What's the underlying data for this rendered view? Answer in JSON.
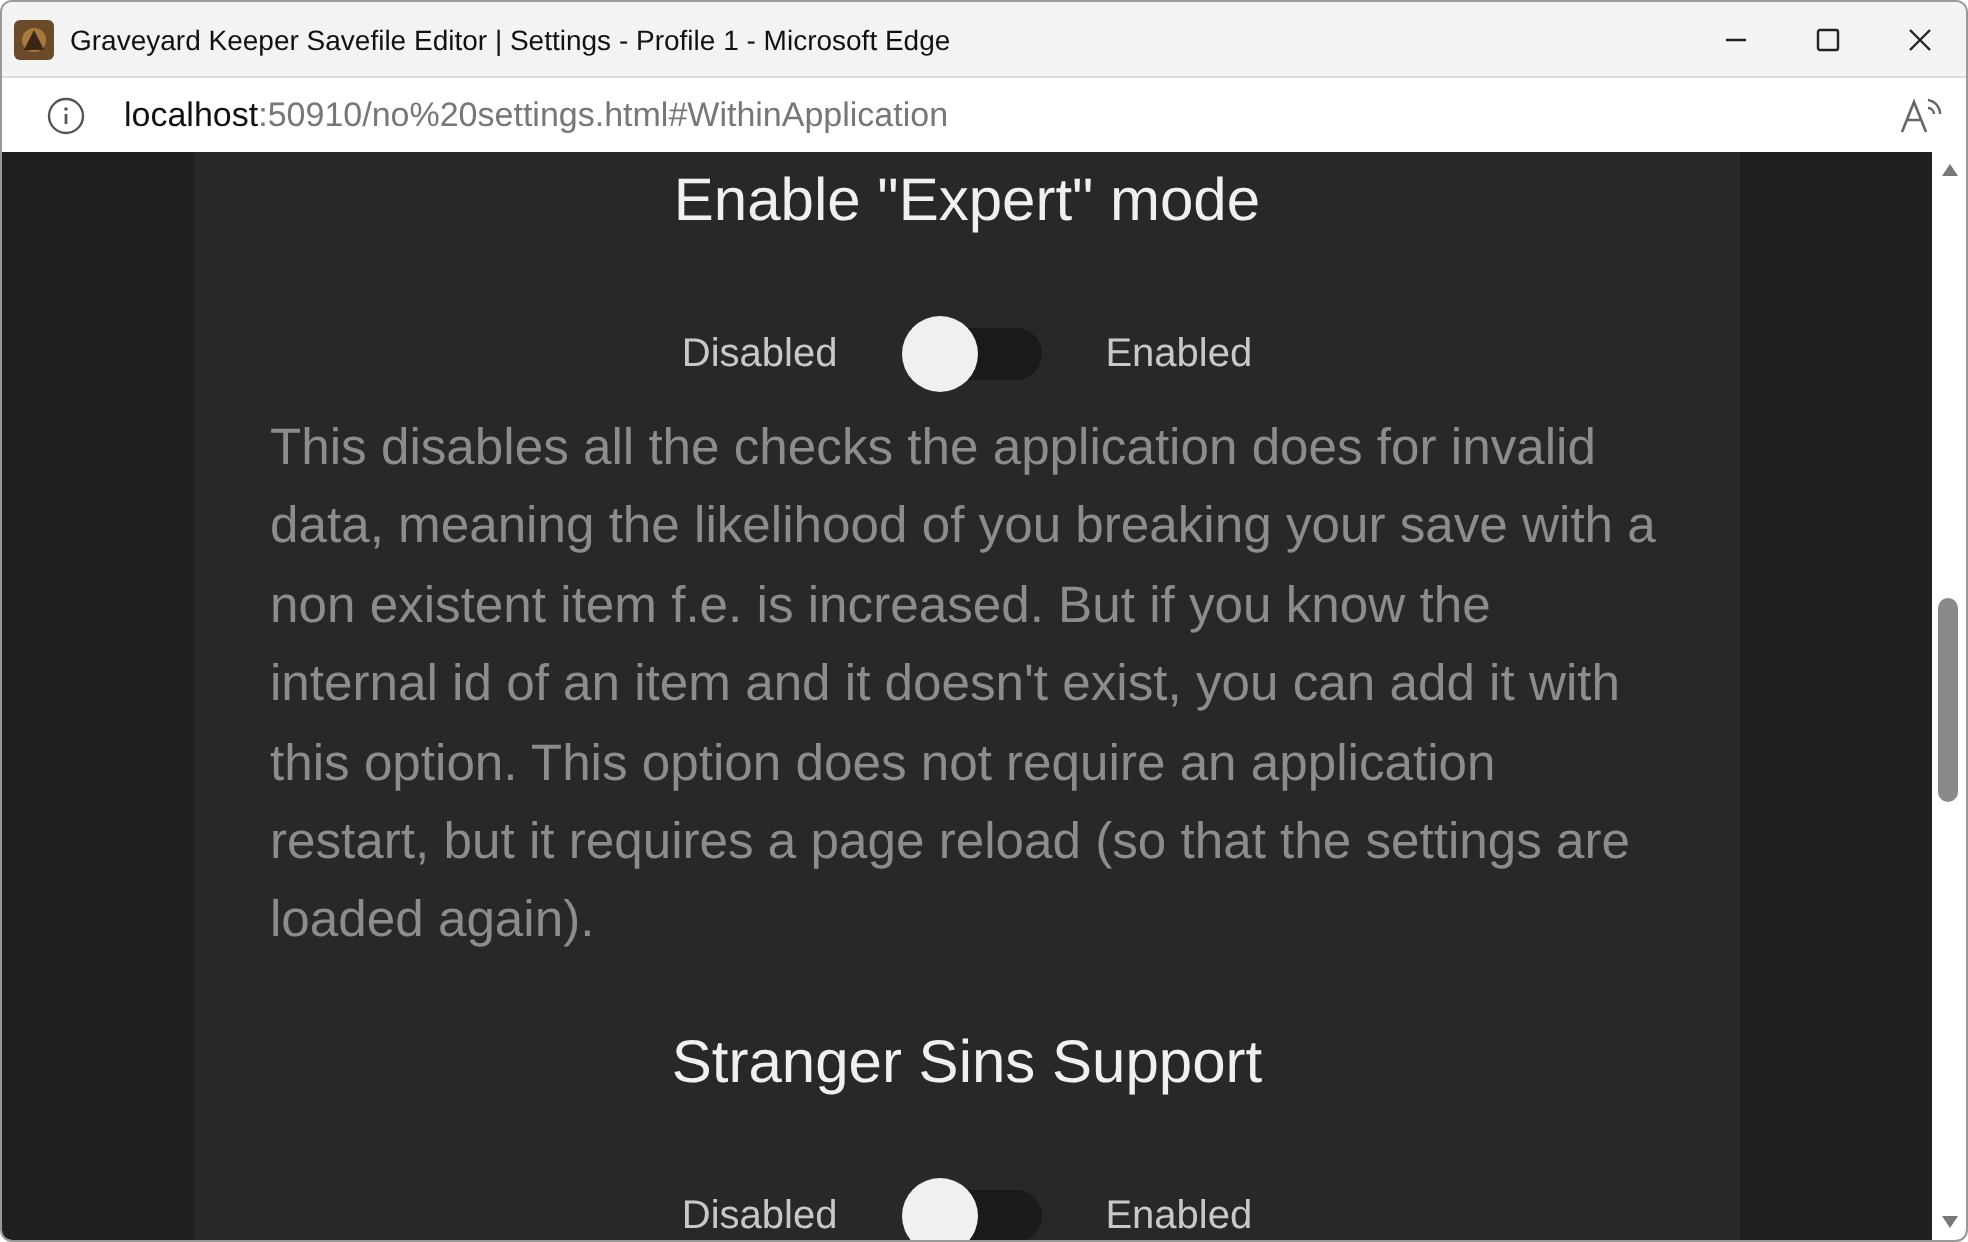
{
  "window": {
    "title": "Graveyard Keeper Savefile Editor | Settings - Profile 1 - Microsoft Edge"
  },
  "address_bar": {
    "host": "localhost",
    "path": ":50910/no%20settings.html#WithinApplication"
  },
  "settings": [
    {
      "heading": "Enable \"Expert\" mode",
      "off_label": "Disabled",
      "on_label": "Enabled",
      "on": false,
      "description": "This disables all the checks the application does for invalid data, meaning the likelihood of you breaking your save with a non existent item f.e. is increased. But if you know the internal id of an item and it doesn't exist, you can add it with this option. This option does not require an application restart, but it requires a page reload (so that the settings are loaded again)."
    },
    {
      "heading": "Stranger Sins Support",
      "off_label": "Disabled",
      "on_label": "Enabled",
      "on": false
    }
  ]
}
